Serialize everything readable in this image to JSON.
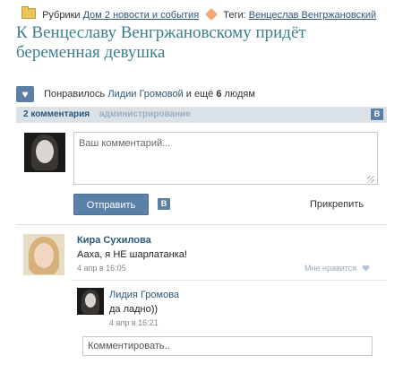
{
  "meta": {
    "rubric_label": "Рубрики",
    "rubric_link": "Дом 2 новости и события",
    "tags_label": "Теги:",
    "tag_link": "Венцеслав Венгржановский"
  },
  "article": {
    "title": "К Венцеславу Венгржановскому придёт беременная девушка"
  },
  "likes": {
    "prefix": "Понравилось",
    "user": "Лидии Громовой",
    "and_more": "и ещё",
    "count": "6",
    "suffix": "людям"
  },
  "tabs": {
    "comments": "2 комментария",
    "admin": "администрирование",
    "vk_label": "В"
  },
  "compose": {
    "placeholder": "Ваш комментарий...",
    "send_label": "Отправить",
    "vk_label": "В",
    "attach_label": "Прикрепить"
  },
  "comments": [
    {
      "author": "Кира Сухилова",
      "text": "Аахa, я НЕ шарлатанка!",
      "date": "4 апр в 16:05",
      "like_label": "Мне нравится"
    },
    {
      "author": "Лидия Громова",
      "text": "да ладно))",
      "date": "4 апр в 16:21"
    }
  ],
  "reply": {
    "placeholder": "Комментировать.."
  },
  "colors": {
    "accent": "#2b587a",
    "title": "#3d7e8c",
    "button": "#5b81a8",
    "tab_bar": "#dae2e8"
  }
}
